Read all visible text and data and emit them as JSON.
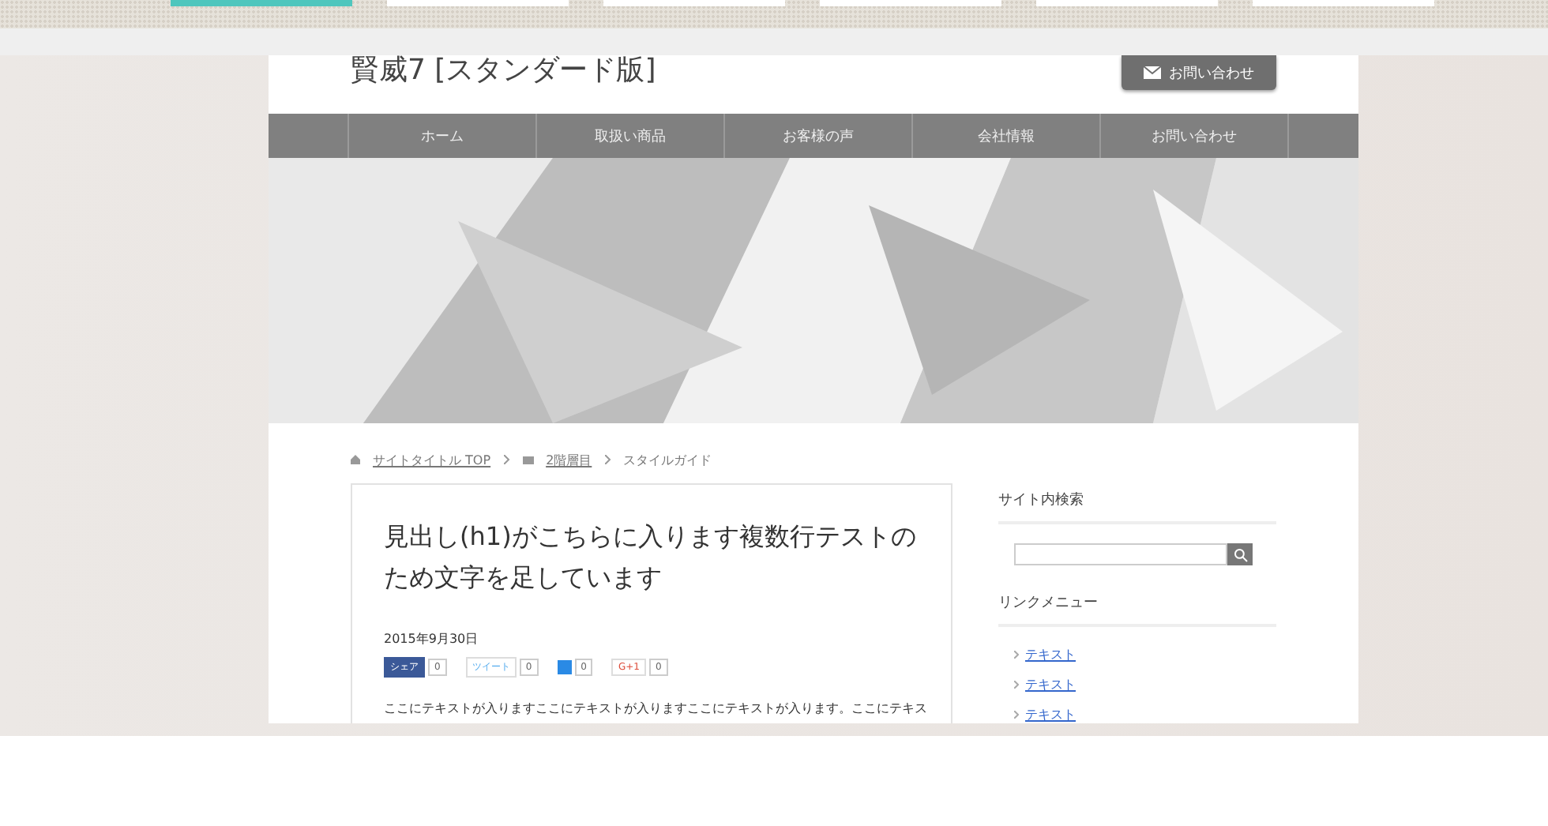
{
  "thumbnails": [
    {
      "selected": true
    },
    {
      "selected": false
    },
    {
      "selected": false
    },
    {
      "selected": false
    },
    {
      "selected": false
    },
    {
      "selected": false
    }
  ],
  "site": {
    "title": "賢威7 [スタンダード版]",
    "contact_button": "お問い合わせ"
  },
  "nav": [
    "ホーム",
    "取扱い商品",
    "お客様の声",
    "会社情報",
    "お問い合わせ"
  ],
  "breadcrumb": [
    {
      "label": "サイトタイトル TOP",
      "kind": "home"
    },
    {
      "label": "2階層目",
      "kind": "folder"
    },
    {
      "label": "スタイルガイド",
      "kind": "current"
    }
  ],
  "article": {
    "title": "見出し(h1)がこちらに入ります複数行テストのため文字を足しています",
    "date": "2015年9月30日",
    "social": [
      {
        "kind": "facebook",
        "label": "シェア",
        "count": "0"
      },
      {
        "kind": "twitter",
        "label": "ツイート",
        "count": "0"
      },
      {
        "kind": "hatena",
        "count": "0"
      },
      {
        "kind": "google",
        "label": "G+1",
        "count": "0"
      }
    ],
    "body": "ここにテキストが入りますここにテキストが入りますここにテキストが入ります。ここにテキス"
  },
  "sidebar": {
    "search_heading": "サイト内検索",
    "menu_heading": "リンクメニュー",
    "links": [
      "テキスト",
      "テキスト",
      "テキスト"
    ]
  }
}
